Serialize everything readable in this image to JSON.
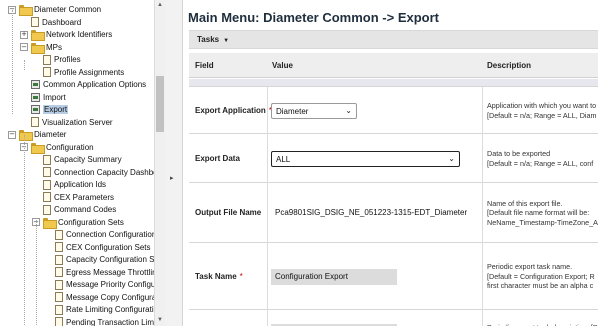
{
  "tree": {
    "items": [
      {
        "label": "Diameter Common",
        "icon": "folder-icon",
        "expander": "−",
        "selected": false
      },
      {
        "label": "Dashboard",
        "icon": "document-icon",
        "expander": "",
        "selected": false
      },
      {
        "label": "Network Identifiers",
        "icon": "folder-icon",
        "expander": "+",
        "selected": false
      },
      {
        "label": "MPs",
        "icon": "folder-icon",
        "expander": "−",
        "selected": false
      },
      {
        "label": "Profiles",
        "icon": "document-icon",
        "expander": "",
        "selected": false
      },
      {
        "label": "Profile Assignments",
        "icon": "document-icon",
        "expander": "",
        "selected": false
      },
      {
        "label": "Common Application Options",
        "icon": "app-icon",
        "expander": "",
        "selected": false
      },
      {
        "label": "Import",
        "icon": "app-icon",
        "expander": "",
        "selected": false
      },
      {
        "label": "Export",
        "icon": "app-icon",
        "expander": "",
        "selected": true
      },
      {
        "label": "Visualization Server",
        "icon": "document-icon",
        "expander": "",
        "selected": false
      },
      {
        "label": "Diameter",
        "icon": "folder-icon",
        "expander": "−",
        "selected": false
      },
      {
        "label": "Configuration",
        "icon": "folder-icon",
        "expander": "−",
        "selected": false
      },
      {
        "label": "Capacity Summary",
        "icon": "document-icon",
        "expander": "",
        "selected": false
      },
      {
        "label": "Connection Capacity Dashbo",
        "icon": "document-icon",
        "expander": "",
        "selected": false
      },
      {
        "label": "Application Ids",
        "icon": "document-icon",
        "expander": "",
        "selected": false
      },
      {
        "label": "CEX Parameters",
        "icon": "document-icon",
        "expander": "",
        "selected": false
      },
      {
        "label": "Command Codes",
        "icon": "document-icon",
        "expander": "",
        "selected": false
      },
      {
        "label": "Configuration Sets",
        "icon": "folder-icon",
        "expander": "−",
        "selected": false
      },
      {
        "label": "Connection Configuration",
        "icon": "document-icon",
        "expander": "",
        "selected": false
      },
      {
        "label": "CEX Configuration Sets",
        "icon": "document-icon",
        "expander": "",
        "selected": false
      },
      {
        "label": "Capacity Configuration Se",
        "icon": "document-icon",
        "expander": "",
        "selected": false
      },
      {
        "label": "Egress Message Throttlin",
        "icon": "document-icon",
        "expander": "",
        "selected": false
      },
      {
        "label": "Message Priority Configu",
        "icon": "document-icon",
        "expander": "",
        "selected": false
      },
      {
        "label": "Message Copy Configura",
        "icon": "document-icon",
        "expander": "",
        "selected": false
      },
      {
        "label": "Rate Limiting Configurati",
        "icon": "document-icon",
        "expander": "",
        "selected": false
      },
      {
        "label": "Pending Transaction Limi",
        "icon": "document-icon",
        "expander": "",
        "selected": false
      }
    ]
  },
  "header": {
    "title": "Main Menu: Diameter Common -> Export",
    "tasks_label": "Tasks",
    "tasks_caret": "▼"
  },
  "grid": {
    "columns": [
      "Field",
      "Value",
      "Description"
    ],
    "rows": [
      {
        "field": "Export Application",
        "required": "*",
        "value": "Diameter",
        "control": "select",
        "description": [
          "Application with which you want to",
          "[Default = n/a; Range = ALL, Diam"
        ]
      },
      {
        "field": "Export Data",
        "required": "",
        "value": "ALL",
        "control": "select-focused",
        "description": [
          "Data to be exported",
          "[Default = n/a; Range = ALL, conf"
        ]
      },
      {
        "field": "Output File Name",
        "required": "",
        "value": "Pca9801SIG_DSIG_NE_051223-1315-EDT_Diameter",
        "control": "text",
        "description": [
          "Name of this export file.",
          "[Default file name format will be:",
          "NeName_Timestamp-TimeZone_A"
        ]
      },
      {
        "field": "Task Name",
        "required": "*",
        "value": "Configuration Export",
        "control": "text-filled",
        "description": [
          "Periodic export task name.",
          "[Default = Configuration Export; R",
          "first character must be an alpha c"
        ]
      },
      {
        "field": "",
        "required": "",
        "value": "",
        "control": "text-filled",
        "description": [
          "Periodic export task description. [D"
        ]
      }
    ]
  },
  "colors": {
    "selected_bg": "#b7cde6",
    "required": "#cc0000",
    "title": "#1f2e3d",
    "folder": "#f1c84e"
  }
}
